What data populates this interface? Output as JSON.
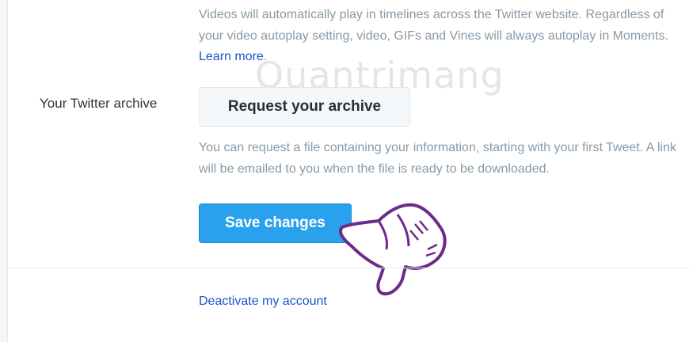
{
  "autoplay": {
    "text": "Videos will automatically play in timelines across the Twitter website. Regardless of your video autoplay setting, video, GIFs and Vines will always autoplay in Moments. ",
    "learn_more": "Learn more",
    "period": "."
  },
  "archive": {
    "label": "Your Twitter archive",
    "button": "Request your archive",
    "help": "You can request a file containing your information, starting with your first Tweet. A link will be emailed to you when the file is ready to be downloaded."
  },
  "actions": {
    "save": "Save changes",
    "deactivate": "Deactivate my account"
  },
  "watermark": "Quantrimang",
  "icons": [
    "pointing-hand-icon"
  ],
  "colors": {
    "primary_button": "#2aa1ec",
    "link": "#1b55c8",
    "muted_text": "#8899a6"
  }
}
